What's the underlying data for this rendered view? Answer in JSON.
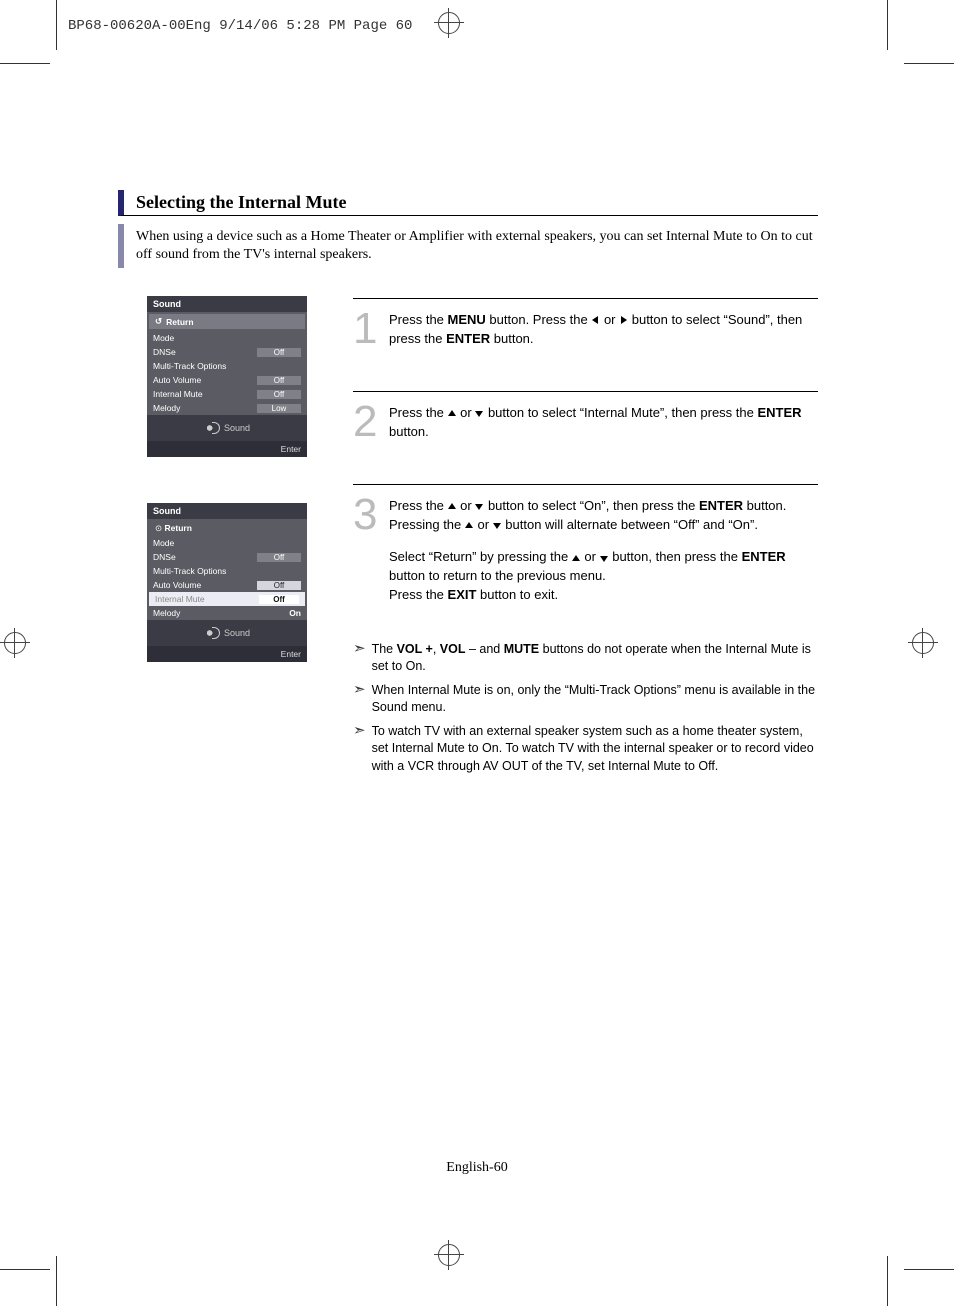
{
  "header": "BP68-00620A-00Eng  9/14/06  5:28 PM  Page 60",
  "title": "Selecting the Internal Mute",
  "intro": "When using a device such as a Home Theater or Amplifier with external speakers, you can set Internal Mute to On to cut off sound from the TV's internal speakers.",
  "steps": {
    "s1a": "Press the ",
    "s1b": "MENU",
    "s1c": " button. Press the ",
    "s1d": " or ",
    "s1e": " button to select “Sound”, then press the ",
    "s1f": "ENTER",
    "s1g": " button.",
    "s2a": "Press the ",
    "s2b": " or ",
    "s2c": " button to select “Internal Mute”, then press the ",
    "s2d": "ENTER",
    "s2e": " button.",
    "s3a": "Press the ",
    "s3b": " or ",
    "s3c": " button to select “On”, then press the ",
    "s3d": "ENTER",
    "s3e": " button. Pressing the ",
    "s3f": " or ",
    "s3g": " button will alternate between “Off” and “On”.",
    "s3h": "Select “Return” by pressing the ",
    "s3i": " or ",
    "s3j": " button, then press the ",
    "s3k": "ENTER",
    "s3l": " button to return to the previous menu.",
    "s3m": "Press the ",
    "s3n": "EXIT",
    "s3o": " button to exit."
  },
  "nums": {
    "n1": "1",
    "n2": "2",
    "n3": "3"
  },
  "notes": {
    "n1a": "The ",
    "n1b": "VOL +",
    "n1c": ", ",
    "n1d": "VOL",
    "n1e": " – and ",
    "n1f": "MUTE",
    "n1g": " buttons do not operate when the Internal Mute is set to On.",
    "n2": "When Internal Mute is on, only the “Multi-Track Options” menu is available in the Sound menu.",
    "n3": "To watch TV with an external speaker system such as a home theater system, set Internal Mute to On. To watch TV with the internal speaker or to record video with a VCR through AV OUT of the TV, set Internal Mute to Off."
  },
  "osd": {
    "title": "Sound",
    "return": "Return",
    "mode": "Mode",
    "dnse": "DNSe",
    "multi": "Multi-Track Options",
    "auto": "Auto Volume",
    "internal": "Internal Mute",
    "melody": "Melody",
    "off": "Off",
    "low": "Low",
    "on": "On",
    "icon_label": "Sound",
    "enter": "Enter"
  },
  "page_number": "English-60",
  "bullet": "➣",
  "enter_sym": "↲"
}
